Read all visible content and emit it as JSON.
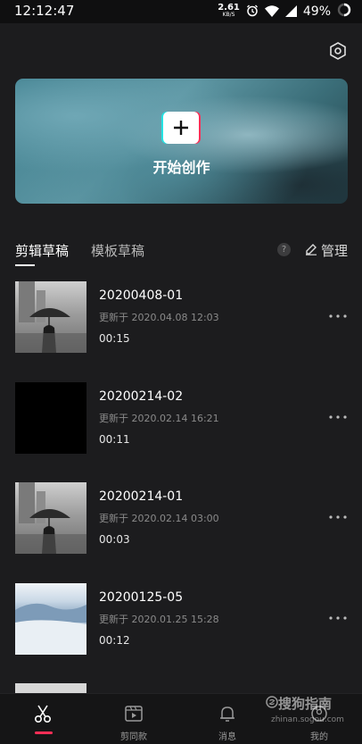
{
  "status_bar": {
    "time": "12:12:47",
    "net_speed_value": "2.61",
    "net_speed_unit": "KB/S",
    "battery": "49%"
  },
  "banner": {
    "label": "开始创作"
  },
  "tabs": [
    {
      "label": "剪辑草稿",
      "active": true
    },
    {
      "label": "模板草稿",
      "active": false
    }
  ],
  "help": "?",
  "manage_label": "管理",
  "drafts": [
    {
      "title": "20200408-01",
      "updated": "更新于 2020.04.08 12:03",
      "duration": "00:15",
      "thumb": "umbrella"
    },
    {
      "title": "20200214-02",
      "updated": "更新于 2020.02.14 16:21",
      "duration": "00:11",
      "thumb": "black"
    },
    {
      "title": "20200214-01",
      "updated": "更新于 2020.02.14 03:00",
      "duration": "00:03",
      "thumb": "umbrella"
    },
    {
      "title": "20200125-05",
      "updated": "更新于 2020.01.25 15:28",
      "duration": "00:12",
      "thumb": "snow"
    }
  ],
  "bottom_nav": [
    {
      "label": "",
      "icon": "scissors-icon",
      "active": true
    },
    {
      "label": "剪同款",
      "icon": "play-box-icon",
      "active": false
    },
    {
      "label": "消息",
      "icon": "bell-icon",
      "active": false
    },
    {
      "label": "我的",
      "icon": "profile-icon",
      "active": false
    }
  ],
  "watermark": {
    "main": "搜狗指南",
    "sub": "zhinan.sogou.com"
  },
  "colors": {
    "accent": "#ff2e56",
    "background": "#1c1c1e"
  }
}
